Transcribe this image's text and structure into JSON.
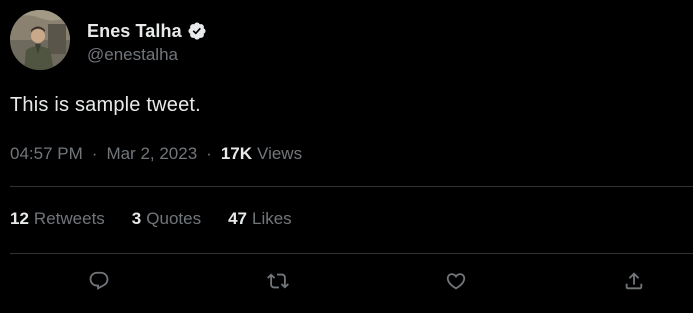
{
  "author": {
    "display_name": "Enes Talha",
    "handle": "@enestalha",
    "avatar_icon": "profile-photo",
    "verified_icon": "verified-badge-icon",
    "verified_color": "#e7e9ea"
  },
  "tweet": {
    "text": "This is sample tweet."
  },
  "meta": {
    "time": "04:57 PM",
    "separator": "·",
    "date": "Mar 2, 2023",
    "views_count": "17K",
    "views_label": "Views"
  },
  "stats": {
    "retweets_count": "12",
    "retweets_label": "Retweets",
    "quotes_count": "3",
    "quotes_label": "Quotes",
    "likes_count": "47",
    "likes_label": "Likes"
  },
  "actions": [
    {
      "name": "reply",
      "icon": "reply-icon"
    },
    {
      "name": "retweet",
      "icon": "retweet-icon"
    },
    {
      "name": "like",
      "icon": "heart-icon"
    },
    {
      "name": "share",
      "icon": "share-icon"
    }
  ],
  "colors": {
    "background": "#000000",
    "primary_text": "#e7e9ea",
    "secondary_text": "#71767b",
    "divider": "#2f3336"
  }
}
